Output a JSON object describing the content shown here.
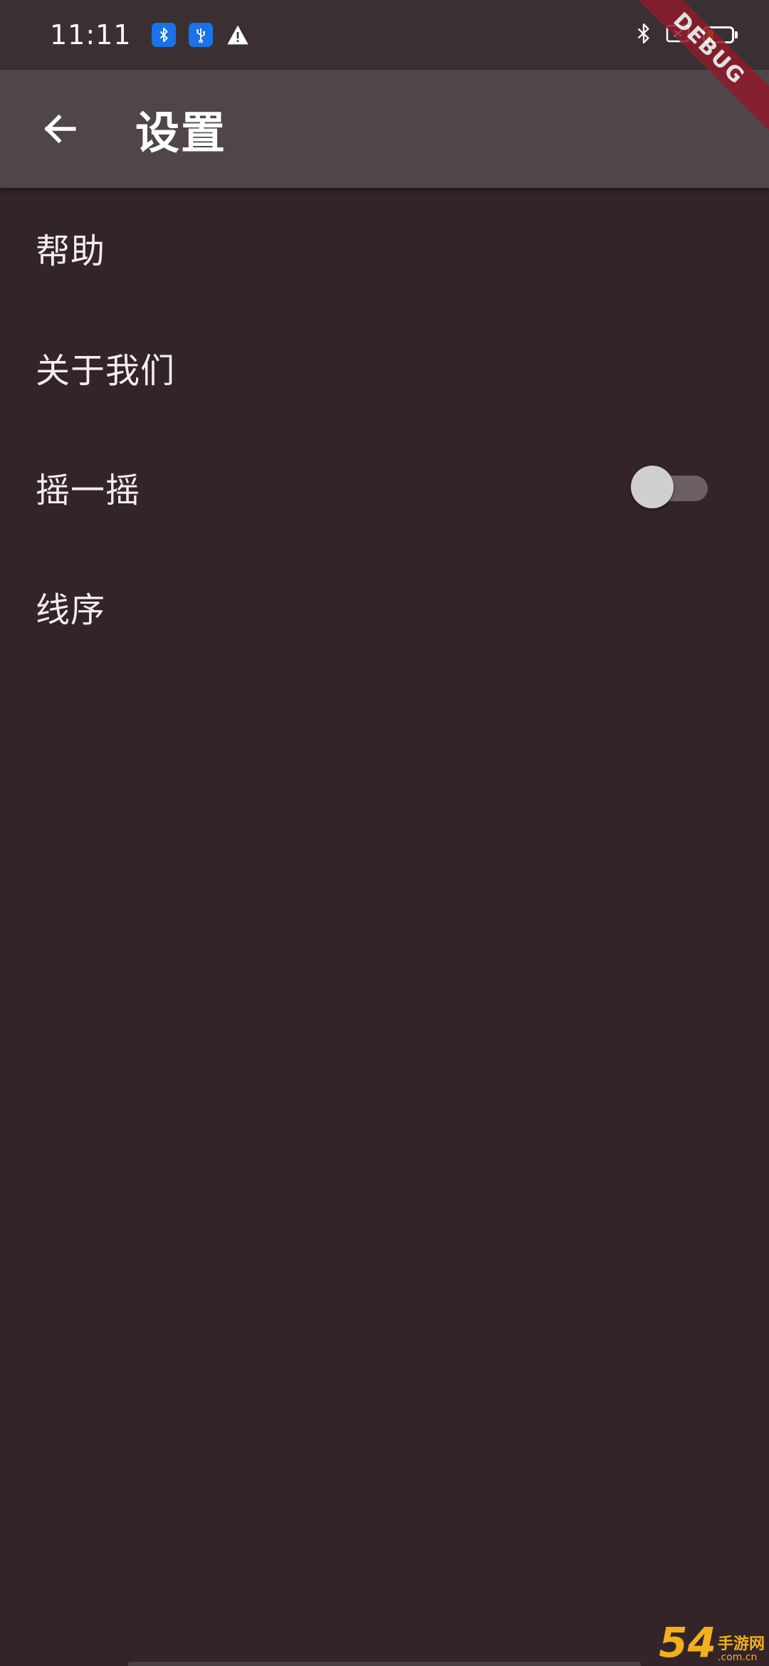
{
  "status_bar": {
    "time": "11:11",
    "icons": [
      "bluetooth-notification-icon",
      "usb-notification-icon",
      "warning-icon",
      "bluetooth-icon",
      "sim-icon",
      "battery-icon"
    ],
    "battery_color": "#f5c518"
  },
  "debug_banner": "DEBUG",
  "app_bar": {
    "back_icon": "arrow-left-icon",
    "title": "设置"
  },
  "settings": {
    "items": [
      {
        "label": "帮助"
      },
      {
        "label": "关于我们"
      },
      {
        "label": "摇一摇",
        "switch_on": false
      },
      {
        "label": "线序"
      }
    ]
  },
  "watermark": {
    "num": "54",
    "cn": "手游网",
    "domain": ".com.cn"
  },
  "colors": {
    "background": "#332427",
    "app_bar": "#50464a",
    "status_bar": "#3a3032",
    "accent_blue": "#1a73e8",
    "debug_red": "#8e1b2a"
  }
}
